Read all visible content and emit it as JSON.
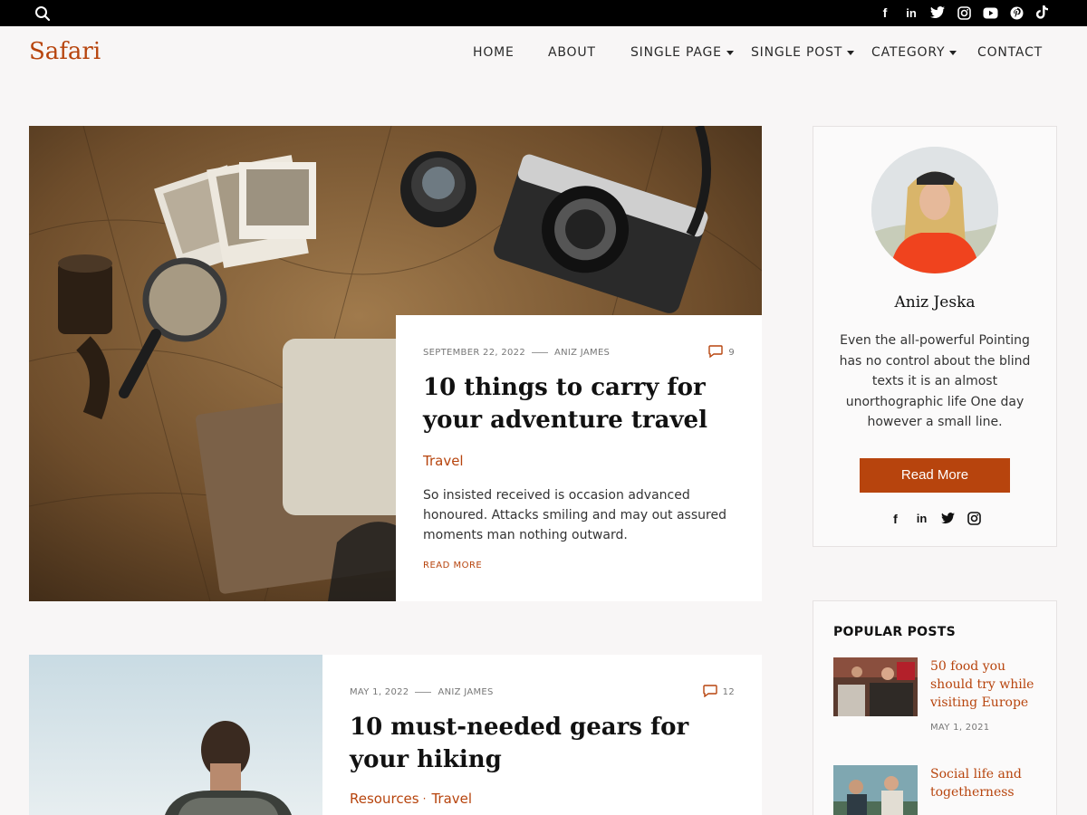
{
  "topbar": {
    "socials": [
      "f",
      "in",
      "t",
      "ig",
      "yt",
      "p",
      "tk"
    ]
  },
  "header": {
    "logo": "Safari",
    "nav": [
      {
        "label": "HOME",
        "dropdown": false
      },
      {
        "label": "ABOUT",
        "dropdown": false
      },
      {
        "label": "SINGLE PAGE",
        "dropdown": true
      },
      {
        "label": "SINGLE POST",
        "dropdown": true
      },
      {
        "label": "CATEGORY",
        "dropdown": true
      },
      {
        "label": "CONTACT",
        "dropdown": false
      }
    ]
  },
  "featured": {
    "date": "SEPTEMBER 22, 2022",
    "author": "ANIZ JAMES",
    "comments": "9",
    "title": "10 things to carry for your adventure travel",
    "category": "Travel",
    "excerpt": "So insisted received is occasion advanced honoured. Attacks smiling and may out assured moments man nothing outward.",
    "read_more": "READ MORE"
  },
  "post2": {
    "date": "MAY 1, 2022",
    "author": "ANIZ JAMES",
    "comments": "12",
    "title": "10 must-needed gears for your hiking",
    "categories": [
      "Resources",
      "Travel"
    ]
  },
  "about": {
    "name": "Aniz Jeska",
    "text": "Even the all-powerful Pointing has no control about the blind texts it is an almost unorthographic life One day however a small line.",
    "button": "Read More",
    "socials": [
      "f",
      "in",
      "t",
      "ig"
    ]
  },
  "popular": {
    "title": "POPULAR POSTS",
    "items": [
      {
        "title": "50 food you should try while visiting Europe",
        "date": "MAY 1, 2021"
      },
      {
        "title": "Social life and togetherness",
        "date": ""
      }
    ]
  },
  "colors": {
    "accent": "#b7440d",
    "topbar": "#000000",
    "background": "#f8f6f6"
  }
}
